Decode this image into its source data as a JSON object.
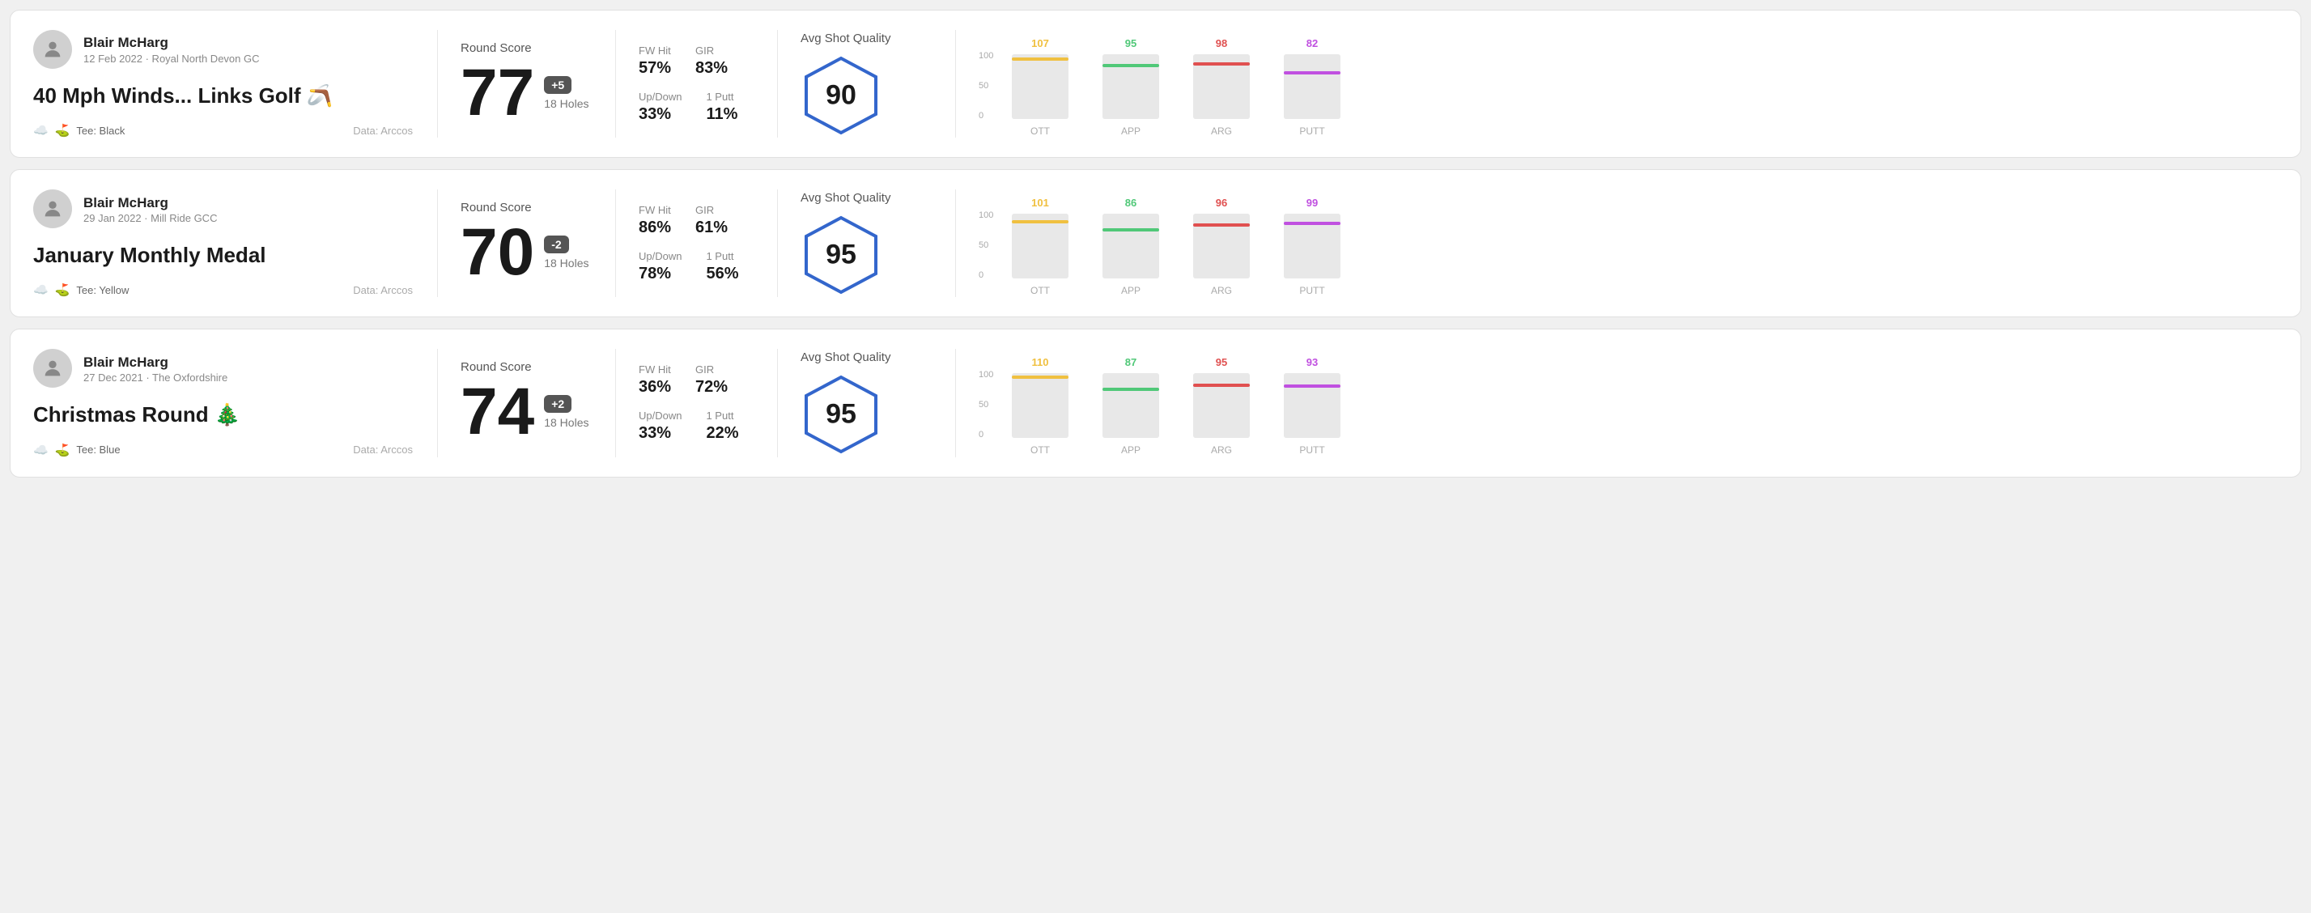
{
  "rounds": [
    {
      "id": "round-1",
      "user": {
        "name": "Blair McHarg",
        "date": "12 Feb 2022 · Royal North Devon GC"
      },
      "title": "40 Mph Winds... Links Golf 🪃",
      "tee": "Black",
      "data_source": "Data: Arccos",
      "score": {
        "value": "77",
        "badge": "+5",
        "holes": "18 Holes"
      },
      "stats": {
        "fw_hit_label": "FW Hit",
        "fw_hit_value": "57%",
        "gir_label": "GIR",
        "gir_value": "83%",
        "updown_label": "Up/Down",
        "updown_value": "33%",
        "oneputt_label": "1 Putt",
        "oneputt_value": "11%"
      },
      "quality": {
        "label": "Avg Shot Quality",
        "score": "90"
      },
      "chart": {
        "bars": [
          {
            "label": "OTT",
            "value": 107,
            "color": "#f0c040",
            "max": 120
          },
          {
            "label": "APP",
            "value": 95,
            "color": "#50c878",
            "max": 120
          },
          {
            "label": "ARG",
            "value": 98,
            "color": "#e05050",
            "max": 120
          },
          {
            "label": "PUTT",
            "value": 82,
            "color": "#c050e0",
            "max": 120
          }
        ]
      }
    },
    {
      "id": "round-2",
      "user": {
        "name": "Blair McHarg",
        "date": "29 Jan 2022 · Mill Ride GCC"
      },
      "title": "January Monthly Medal",
      "tee": "Yellow",
      "data_source": "Data: Arccos",
      "score": {
        "value": "70",
        "badge": "-2",
        "holes": "18 Holes"
      },
      "stats": {
        "fw_hit_label": "FW Hit",
        "fw_hit_value": "86%",
        "gir_label": "GIR",
        "gir_value": "61%",
        "updown_label": "Up/Down",
        "updown_value": "78%",
        "oneputt_label": "1 Putt",
        "oneputt_value": "56%"
      },
      "quality": {
        "label": "Avg Shot Quality",
        "score": "95"
      },
      "chart": {
        "bars": [
          {
            "label": "OTT",
            "value": 101,
            "color": "#f0c040",
            "max": 120
          },
          {
            "label": "APP",
            "value": 86,
            "color": "#50c878",
            "max": 120
          },
          {
            "label": "ARG",
            "value": 96,
            "color": "#e05050",
            "max": 120
          },
          {
            "label": "PUTT",
            "value": 99,
            "color": "#c050e0",
            "max": 120
          }
        ]
      }
    },
    {
      "id": "round-3",
      "user": {
        "name": "Blair McHarg",
        "date": "27 Dec 2021 · The Oxfordshire"
      },
      "title": "Christmas Round 🎄",
      "tee": "Blue",
      "data_source": "Data: Arccos",
      "score": {
        "value": "74",
        "badge": "+2",
        "holes": "18 Holes"
      },
      "stats": {
        "fw_hit_label": "FW Hit",
        "fw_hit_value": "36%",
        "gir_label": "GIR",
        "gir_value": "72%",
        "updown_label": "Up/Down",
        "updown_value": "33%",
        "oneputt_label": "1 Putt",
        "oneputt_value": "22%"
      },
      "quality": {
        "label": "Avg Shot Quality",
        "score": "95"
      },
      "chart": {
        "bars": [
          {
            "label": "OTT",
            "value": 110,
            "color": "#f0c040",
            "max": 120
          },
          {
            "label": "APP",
            "value": 87,
            "color": "#50c878",
            "max": 120
          },
          {
            "label": "ARG",
            "value": 95,
            "color": "#e05050",
            "max": 120
          },
          {
            "label": "PUTT",
            "value": 93,
            "color": "#c050e0",
            "max": 120
          }
        ]
      }
    }
  ],
  "chart_y_labels": [
    "100",
    "50",
    "0"
  ]
}
